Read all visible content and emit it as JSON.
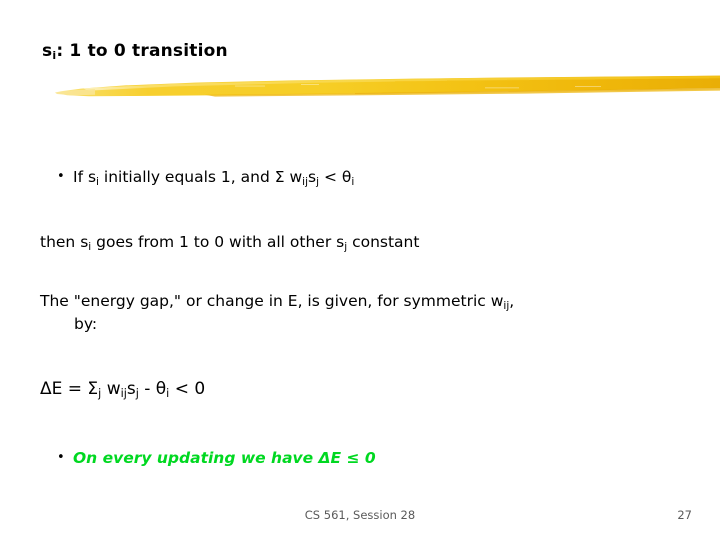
{
  "slide": {
    "title": {
      "prefix": "s",
      "subscript": "i",
      "rest": ": 1 to 0 transition"
    },
    "divider": {
      "name": "yellow-brush-stroke",
      "color_light": "#F9DC5C",
      "color_mid": "#F5C518",
      "color_dark": "#E8B008"
    },
    "bullets": [
      {
        "marker": "•",
        "parts": {
          "t1": "If s",
          "sub1": "i",
          "t2": " initially equals 1, and Σ w",
          "sub2": "ij",
          "t3": "s",
          "sub3": "j",
          "t4": " < θ",
          "sub4": "i"
        }
      }
    ],
    "line_then": {
      "t1": "then s",
      "sub1": "i",
      "t2": " goes from 1 to 0 with all other s",
      "sub2": "j",
      "t3": " constant"
    },
    "line_energy_gap": {
      "t1": "The \"energy gap,\" or change in E, is given, for symmetric w",
      "sub1": "ij",
      "t2": ",",
      "continuation": "by:"
    },
    "equation": {
      "t1": "ΔE = Σ",
      "sub1": "j",
      "t2": " w",
      "sub2": "ij",
      "t3": "s",
      "sub3": "j",
      "t4": " - θ",
      "sub4": "i",
      "t5": " < 0"
    },
    "green_bullet": {
      "marker": "•",
      "text": "On every updating we have ΔE ≤ 0",
      "color": "#00D821"
    },
    "footer": {
      "center": "CS 561, Session 28",
      "page": "27"
    }
  }
}
